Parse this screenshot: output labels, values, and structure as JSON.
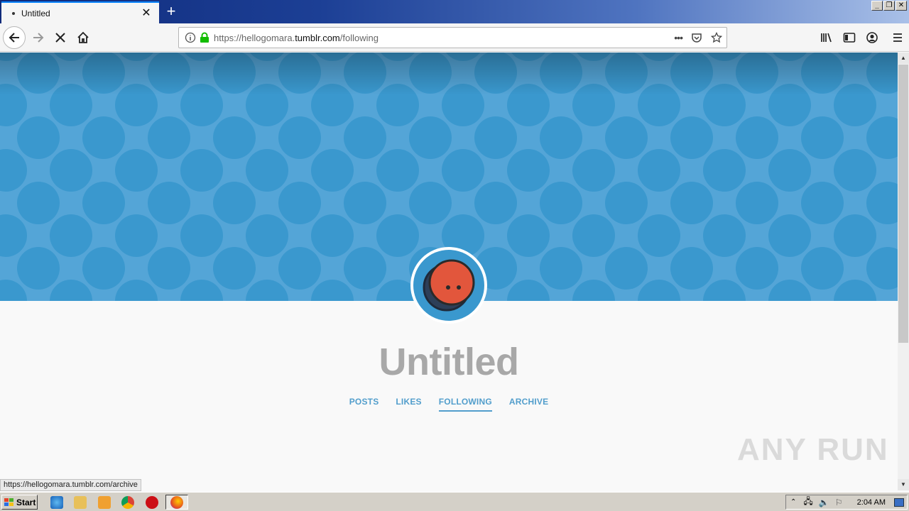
{
  "browser": {
    "tab_title": "Untitled",
    "url_prefix": "https://hellogomara.",
    "url_domain": "tumblr.com",
    "url_path": "/following",
    "status_link": "https://hellogomara.tumblr.com/archive"
  },
  "page": {
    "blog_title": "Untitled",
    "nav": [
      {
        "label": "POSTS",
        "active": false
      },
      {
        "label": "LIKES",
        "active": false
      },
      {
        "label": "FOLLOWING",
        "active": true
      },
      {
        "label": "ARCHIVE",
        "active": false
      }
    ],
    "header_color": "#54a5d7",
    "pattern_color": "#3a98ce",
    "link_color": "#529ecc"
  },
  "watermark": "ANY RUN",
  "taskbar": {
    "start_label": "Start",
    "clock": "2:04 AM"
  }
}
